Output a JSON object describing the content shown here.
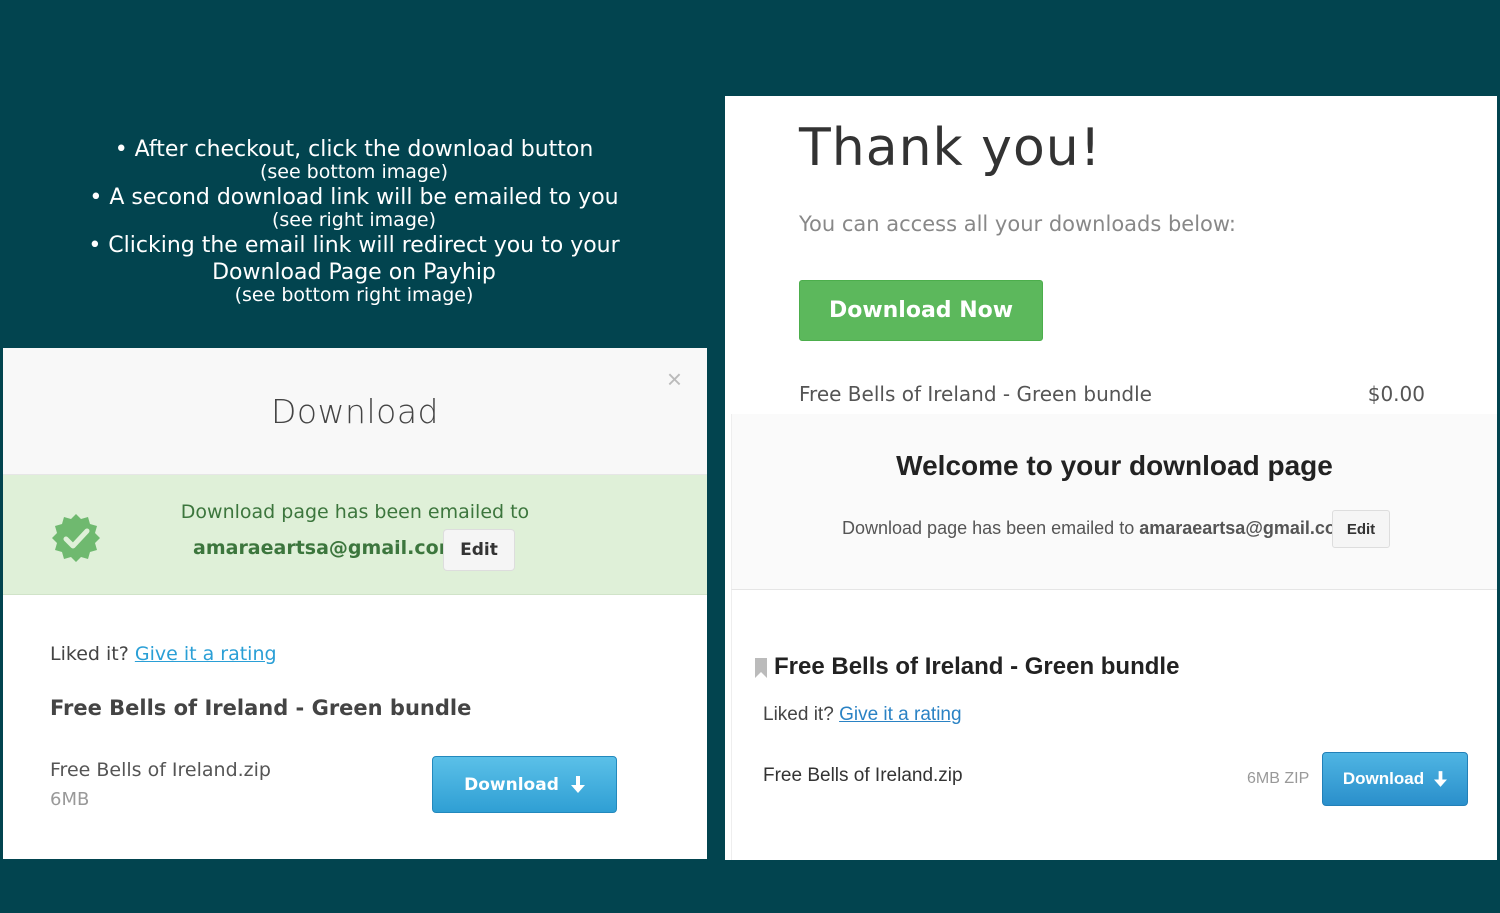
{
  "instructions": {
    "line1": "• After checkout, click the download button",
    "line1_sub": "(see bottom image)",
    "line2": "• A second download link will be emailed to you",
    "line2_sub": "(see right image)",
    "line3a": "• Clicking the email link will redirect you to your",
    "line3b": "Download Page on Payhip",
    "line3_sub": "(see bottom right image)"
  },
  "left_modal": {
    "title": "Download",
    "close_symbol": "×",
    "banner_text": "Download page has been emailed to",
    "email": "amaraeartsa@gmail.com",
    "edit_label": "Edit",
    "liked_prefix": "Liked it?",
    "rating_link": "Give it a rating",
    "product_title": "Free Bells of Ireland - Green bundle",
    "file_name": "Free Bells of Ireland.zip",
    "file_size": "6MB",
    "download_label": "Download",
    "download_icon": "download-arrow-icon",
    "banner_icon": "verified-check-icon"
  },
  "right_panel": {
    "thank_you": "Thank you!",
    "access_text": "You can access all your downloads below:",
    "download_now_label": "Download Now",
    "order_item_name": "Free Bells of Ireland - Green bundle",
    "order_item_price": "$0.00",
    "welcome_title": "Welcome to your download page",
    "emailed_prefix": "Download page has been emailed to",
    "email": "amaraeartsa@gmail.com",
    "edit_label": "Edit",
    "product_title": "Free Bells of Ireland - Green bundle",
    "liked_prefix": "Liked it?",
    "rating_link": "Give it a rating",
    "file_name": "Free Bells of Ireland.zip",
    "file_size": "6MB ZIP",
    "download_label": "Download",
    "download_icon": "download-arrow-icon",
    "bookmark_icon": "bookmark-icon"
  },
  "colors": {
    "background": "#02444f",
    "success_green": "#5cb85c",
    "banner_green": "#dff0d8",
    "download_blue": "#2f9fd4",
    "link_blue": "#2a9fd6"
  }
}
